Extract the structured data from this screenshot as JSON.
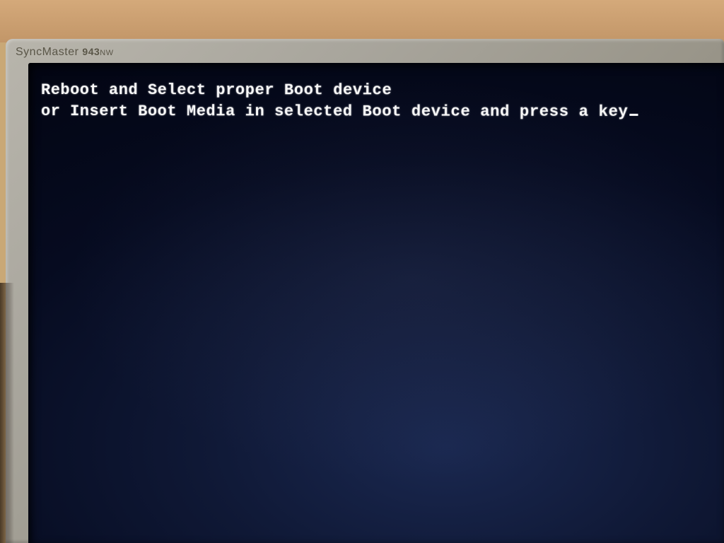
{
  "monitor": {
    "brand": "SyncMaster",
    "model": "943",
    "suffix": "NW"
  },
  "bios": {
    "line1": "Reboot and Select proper Boot device",
    "line2": "or Insert Boot Media in selected Boot device and press a key"
  }
}
